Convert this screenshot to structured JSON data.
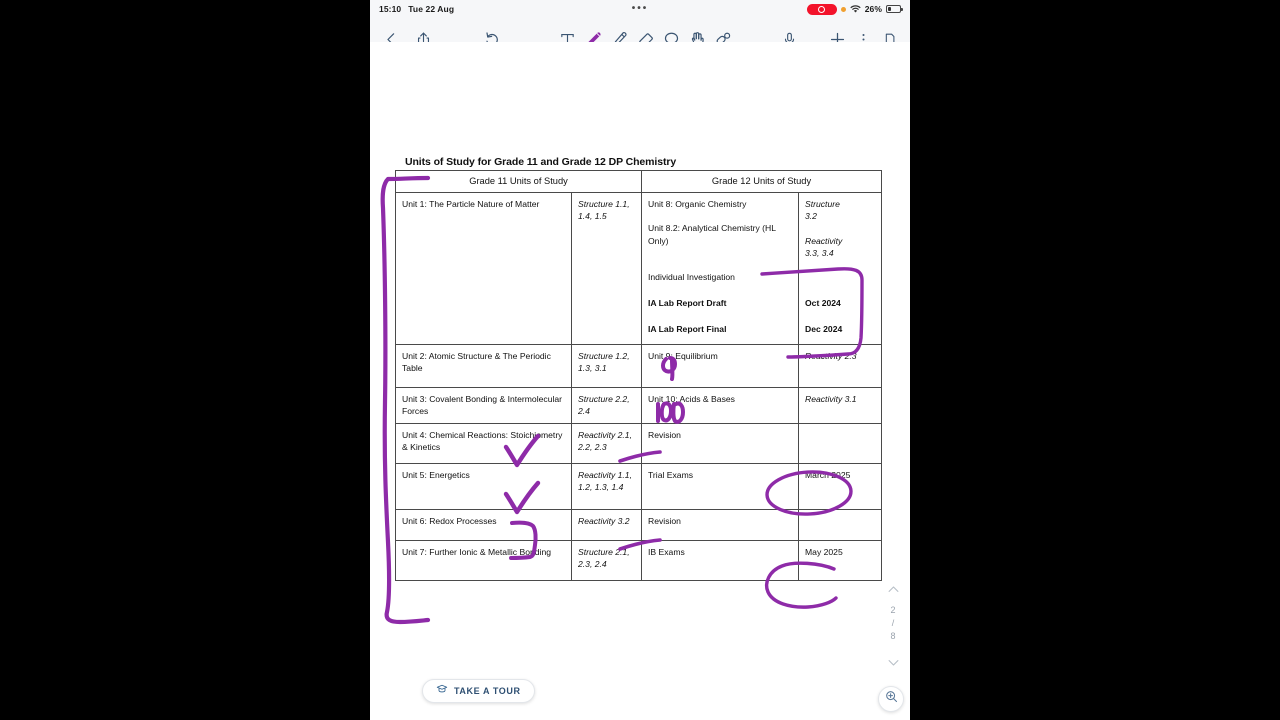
{
  "status_bar": {
    "time": "15:10",
    "date": "Tue 22 Aug",
    "center_dots": "•••",
    "battery_percent": "26%",
    "recording_icon": "screen-recording-indicator",
    "privacy_dot": "orange-privacy-dot",
    "wifi_icon": "wifi-icon"
  },
  "toolbar": {
    "items": [
      {
        "name": "back-button",
        "icon": "chevron-left-icon"
      },
      {
        "name": "share-button",
        "icon": "share-icon"
      },
      {
        "name": "undo-button",
        "icon": "undo-icon"
      },
      {
        "name": "text-tool",
        "icon": "text-tool-icon"
      },
      {
        "name": "pen-tool",
        "icon": "pen-icon",
        "active": true
      },
      {
        "name": "highlighter-tool",
        "icon": "highlighter-icon"
      },
      {
        "name": "eraser-tool",
        "icon": "eraser-icon"
      },
      {
        "name": "lasso-tool",
        "icon": "lasso-icon"
      },
      {
        "name": "hand-tool",
        "icon": "hand-icon"
      },
      {
        "name": "shape-tool",
        "icon": "shape-tool-icon"
      },
      {
        "name": "microphone-button",
        "icon": "microphone-icon"
      },
      {
        "name": "add-button",
        "icon": "plus-icon"
      },
      {
        "name": "more-button",
        "icon": "more-vertical-icon"
      },
      {
        "name": "pages-button",
        "icon": "page-duplicate-icon"
      }
    ],
    "accent_color": "#3b5572",
    "pen_color": "#8e2ba8"
  },
  "document": {
    "title": "Units of Study for Grade 11 and Grade 12 DP Chemistry",
    "table": {
      "headers": [
        "Grade 11 Units of Study",
        "Grade 12 Units of Study"
      ],
      "rows": [
        {
          "g11": "Unit 1: The Particle Nature of Matter",
          "g11_code": "Structure 1.1, 1.4, 1.5",
          "g12_lines": [
            {
              "text": "Unit 8: Organic Chemistry",
              "bold": false
            },
            {
              "text": "Unit 8.2: Analytical Chemistry (HL Only)",
              "bold": false
            },
            {
              "text": "Individual Investigation",
              "bold": false
            },
            {
              "text": "IA Lab Report Draft",
              "bold": true
            },
            {
              "text": "IA Lab Report Final",
              "bold": true
            }
          ],
          "g12_code_lines": [
            {
              "text": "Structure",
              "italic": true
            },
            {
              "text": "3.2",
              "italic": true
            },
            {
              "text": "Reactivity",
              "italic": true
            },
            {
              "text": "3.3, 3.4",
              "italic": true
            },
            {
              "text": "Oct 2024",
              "bold": true
            },
            {
              "text": "Dec 2024",
              "bold": true
            }
          ]
        },
        {
          "g11": "Unit 2: Atomic Structure & The Periodic Table",
          "g11_code": "Structure 1.2, 1.3, 3.1",
          "g12": "Unit 9: Equilibrium",
          "g12_code": "Reactivity 2.3"
        },
        {
          "g11": "Unit 3: Covalent Bonding & Intermolecular Forces",
          "g11_code": "Structure 2.2, 2.4",
          "g12": "Unit 10: Acids & Bases",
          "g12_code": "Reactivity 3.1"
        },
        {
          "g11": "Unit 4: Chemical Reactions: Stoichiometry & Kinetics",
          "g11_code": "Reactivity 2.1, 2.2, 2.3",
          "g12": "Revision",
          "g12_code": ""
        },
        {
          "g11": "Unit 5: Energetics",
          "g11_code": "Reactivity 1.1, 1.2, 1.3, 1.4",
          "g12": "Trial Exams",
          "g12_bold": true,
          "g12_code": "March 2025",
          "g12_code_bold": true
        },
        {
          "g11": "Unit 6: Redox Processes",
          "g11_code": "Reactivity 3.2",
          "g12": "Revision",
          "g12_code": ""
        },
        {
          "g11": "Unit 7: Further Ionic & Metallic Bonding",
          "g11_code": "Structure 2.1, 2.3, 2.4",
          "g12": "IB Exams",
          "g12_bold": true,
          "g12_code": "May 2025",
          "g12_code_bold": true
        }
      ]
    },
    "annotations": {
      "ink_color": "#8e2ba8",
      "marks": [
        "left-bracket-spanning-all-grade-11-units",
        "bracket-around-oct-2024-and-dec-2024",
        "scribble-over-unit-9-number",
        "scribble-over-unit-10-number",
        "underline-under-revision-row-4",
        "checkmark-unit-4",
        "checkmark-unit-5",
        "bracket-unit-6",
        "underline-under-revision-row-6",
        "circle-around-march-2025",
        "circle-around-may-2025"
      ]
    }
  },
  "bottom_bar": {
    "take_tour_label": "TAKE A TOUR",
    "take_tour_icon": "graduation-cap-icon",
    "zoom_icon": "zoom-in-icon"
  },
  "page_nav": {
    "up_icon": "chevron-up-icon",
    "current_page": "2",
    "separator": "/",
    "total_pages": "8",
    "down_icon": "chevron-down-icon"
  }
}
